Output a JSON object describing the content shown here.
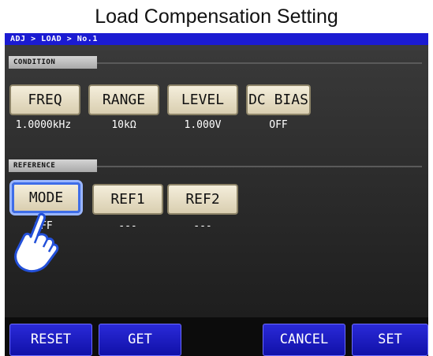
{
  "title": "Load Compensation Setting",
  "breadcrumb": "ADJ > LOAD > No.1",
  "condition": {
    "label": "CONDITION",
    "items": [
      {
        "button": "FREQ",
        "value": "1.0000kHz"
      },
      {
        "button": "RANGE",
        "value": "10kΩ"
      },
      {
        "button": "LEVEL",
        "value": "1.000V"
      },
      {
        "button": "DC BIAS",
        "value": "OFF"
      }
    ]
  },
  "reference": {
    "label": "REFERENCE",
    "items": [
      {
        "button": "MODE",
        "value": "OFF"
      },
      {
        "button": "REF1",
        "value": "---"
      },
      {
        "button": "REF2",
        "value": "---"
      }
    ]
  },
  "bottom": {
    "reset": "RESET",
    "get": "GET",
    "cancel": "CANCEL",
    "set": "SET"
  },
  "colors": {
    "breadcrumb_bg": "#1b1bd2",
    "button_face": "#ece4c8",
    "bottom_button": "#1a1ac4",
    "selection": "#3e6de8"
  },
  "icons": [
    "pointing-hand-icon"
  ]
}
